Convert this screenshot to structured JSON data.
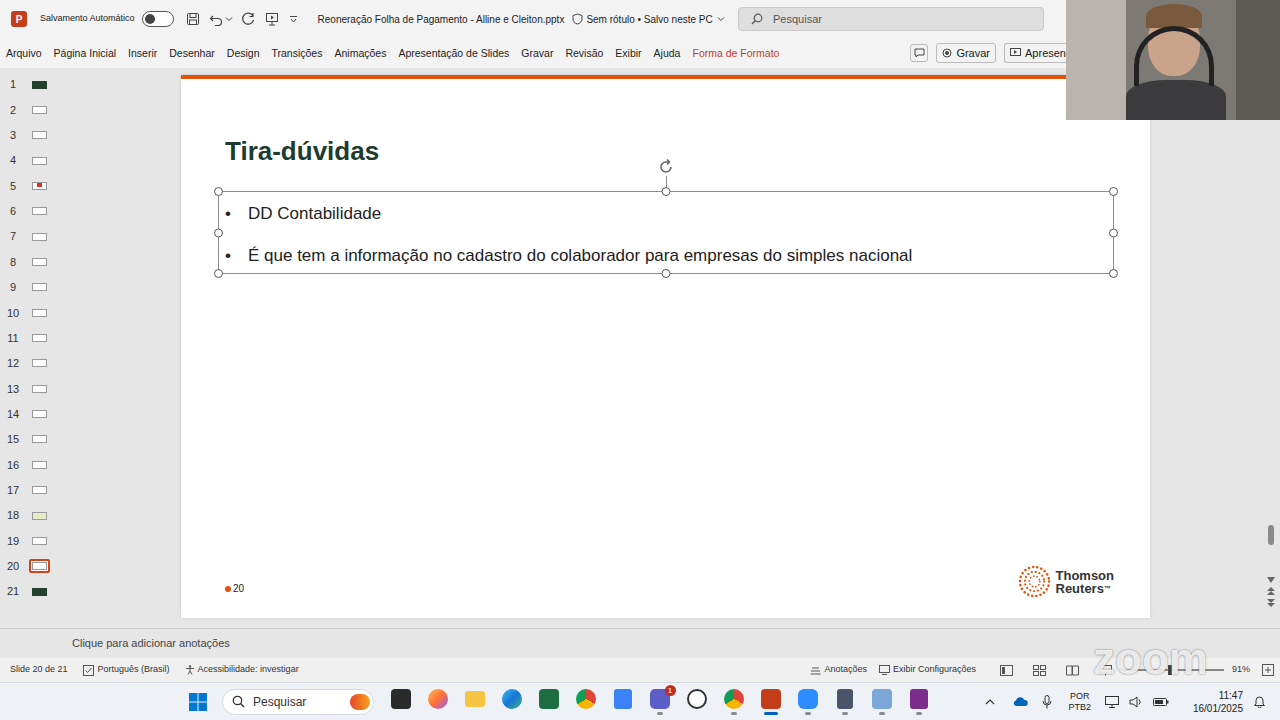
{
  "title_bar": {
    "app_letter": "P",
    "autosave_label": "Salvamento Automático",
    "autosave_on": false,
    "file_name": "Reoneração Folha de Pagamento - Alline e Cleiton.pptx",
    "sensitivity": "Sem rótulo • Salvo neste PC",
    "search_placeholder": "Pesquisar"
  },
  "ribbon": {
    "tabs": [
      {
        "label": "Arquivo",
        "kind": "standard",
        "selected": false
      },
      {
        "label": "Página Inicial",
        "kind": "standard",
        "selected": false
      },
      {
        "label": "Inserir",
        "kind": "standard",
        "selected": false
      },
      {
        "label": "Desenhar",
        "kind": "standard",
        "selected": false
      },
      {
        "label": "Design",
        "kind": "standard",
        "selected": false
      },
      {
        "label": "Transições",
        "kind": "standard",
        "selected": false
      },
      {
        "label": "Animações",
        "kind": "standard",
        "selected": false
      },
      {
        "label": "Apresentação de Slides",
        "kind": "standard",
        "selected": false
      },
      {
        "label": "Gravar",
        "kind": "standard",
        "selected": false
      },
      {
        "label": "Revisão",
        "kind": "standard",
        "selected": false
      },
      {
        "label": "Exibir",
        "kind": "standard",
        "selected": false
      },
      {
        "label": "Ajuda",
        "kind": "standard",
        "selected": false
      },
      {
        "label": "Forma de Formato",
        "kind": "contextual",
        "selected": false
      }
    ],
    "record_button": "Gravar",
    "present_button": "Apresen"
  },
  "thumbnails": [
    {
      "number": "1",
      "kind": "dark",
      "selected": false
    },
    {
      "number": "2",
      "kind": "light",
      "selected": false
    },
    {
      "number": "3",
      "kind": "light",
      "selected": false
    },
    {
      "number": "4",
      "kind": "light",
      "selected": false
    },
    {
      "number": "5",
      "kind": "accent",
      "selected": false
    },
    {
      "number": "6",
      "kind": "light",
      "selected": false
    },
    {
      "number": "7",
      "kind": "light",
      "selected": false
    },
    {
      "number": "8",
      "kind": "light",
      "selected": false
    },
    {
      "number": "9",
      "kind": "light",
      "selected": false
    },
    {
      "number": "10",
      "kind": "light",
      "selected": false
    },
    {
      "number": "11",
      "kind": "light",
      "selected": false
    },
    {
      "number": "12",
      "kind": "light",
      "selected": false
    },
    {
      "number": "13",
      "kind": "light",
      "selected": false
    },
    {
      "number": "14",
      "kind": "light",
      "selected": false
    },
    {
      "number": "15",
      "kind": "light",
      "selected": false
    },
    {
      "number": "16",
      "kind": "light",
      "selected": false
    },
    {
      "number": "17",
      "kind": "light",
      "selected": false
    },
    {
      "number": "18",
      "kind": "green",
      "selected": false
    },
    {
      "number": "19",
      "kind": "light",
      "selected": false
    },
    {
      "number": "20",
      "kind": "light",
      "selected": true
    },
    {
      "number": "21",
      "kind": "dark",
      "selected": false
    }
  ],
  "slide": {
    "title": "Tira-dúvidas",
    "bullets": [
      {
        "marker": "•",
        "text": "DD Contabilidade"
      },
      {
        "marker": "•",
        "text": "É que tem a informação no cadastro do colaborador para empresas do simples nacional"
      }
    ],
    "page_number": "20",
    "logo": {
      "line1": "Thomson",
      "line2": "Reuters",
      "trademark": "™"
    }
  },
  "notes": {
    "placeholder": "Clique para adicionar anotações"
  },
  "status_bar": {
    "slide_info": "Slide 20 de 21",
    "language": "Português (Brasil)",
    "accessibility": "Acessibilidade: investigar",
    "notes_button": "Anotações",
    "display_button": "Exibir Configurações",
    "zoom": "91%"
  },
  "overlay": {
    "watermark": "zoom"
  },
  "taskbar": {
    "search_placeholder": "Pesquisar",
    "apps": [
      {
        "running": false,
        "selected": false,
        "badge": ""
      },
      {
        "running": false,
        "selected": false,
        "badge": ""
      },
      {
        "running": false,
        "selected": false,
        "badge": ""
      },
      {
        "running": false,
        "selected": false,
        "badge": ""
      },
      {
        "running": false,
        "selected": false,
        "badge": ""
      },
      {
        "running": false,
        "selected": false,
        "badge": ""
      },
      {
        "running": false,
        "selected": false,
        "badge": ""
      },
      {
        "running": true,
        "selected": false,
        "badge": "1"
      },
      {
        "running": false,
        "selected": false,
        "badge": ""
      },
      {
        "running": true,
        "selected": false,
        "badge": ""
      },
      {
        "running": true,
        "selected": true,
        "badge": ""
      },
      {
        "running": true,
        "selected": false,
        "badge": ""
      },
      {
        "running": true,
        "selected": false,
        "badge": ""
      },
      {
        "running": true,
        "selected": false,
        "badge": ""
      },
      {
        "running": true,
        "selected": false,
        "badge": ""
      }
    ],
    "input_language": "POR",
    "keyboard_layout": "PTB2",
    "time": "11:47",
    "date": "16/01/2025"
  }
}
